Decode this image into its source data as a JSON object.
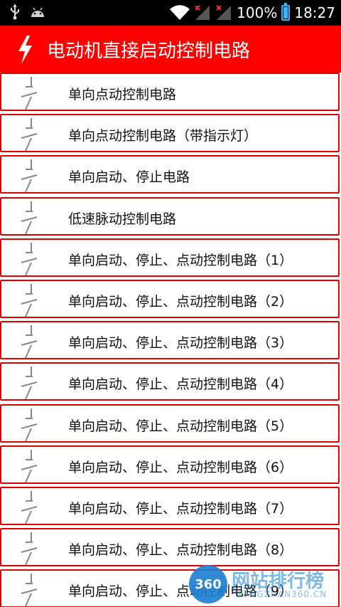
{
  "status_bar": {
    "left_icons": [
      "usb-icon",
      "android-icon"
    ],
    "right_icons": [
      "wifi-icon",
      "signal-no-sim-icon-1",
      "signal-no-sim-icon-2",
      "battery-icon"
    ],
    "battery": "100%",
    "time": "18:27",
    "battery_level": 1.0
  },
  "app_bar": {
    "icon": "lightning-bolt-icon",
    "title": "电动机直接启动控制电路"
  },
  "list": {
    "item_icon": "switch-contact-icon",
    "items": [
      {
        "label": "单向点动控制电路"
      },
      {
        "label": "单向点动控制电路（带指示灯）"
      },
      {
        "label": "单向启动、停止电路"
      },
      {
        "label": "低速脉动控制电路"
      },
      {
        "label": "单向启动、停止、点动控制电路（1）"
      },
      {
        "label": "单向启动、停止、点动控制电路（2）"
      },
      {
        "label": "单向启动、停止、点动控制电路（3）"
      },
      {
        "label": "单向启动、停止、点动控制电路（4）"
      },
      {
        "label": "单向启动、停止、点动控制电路（5）"
      },
      {
        "label": "单向启动、停止、点动控制电路（6）"
      },
      {
        "label": "单向启动、停止、点动控制电路（7）"
      },
      {
        "label": "单向启动、停止、点动控制电路（8）"
      },
      {
        "label": "单向启动、停止、点动控制电路（9）"
      }
    ]
  },
  "colors": {
    "app_bar": "#ff0000",
    "row_border": "#e00000",
    "status_bar": "#000000",
    "battery": "#38b6ff"
  },
  "watermark": {
    "badge": "360",
    "text": "网站排行榜",
    "sub": "WANGZHAN360.CN"
  }
}
